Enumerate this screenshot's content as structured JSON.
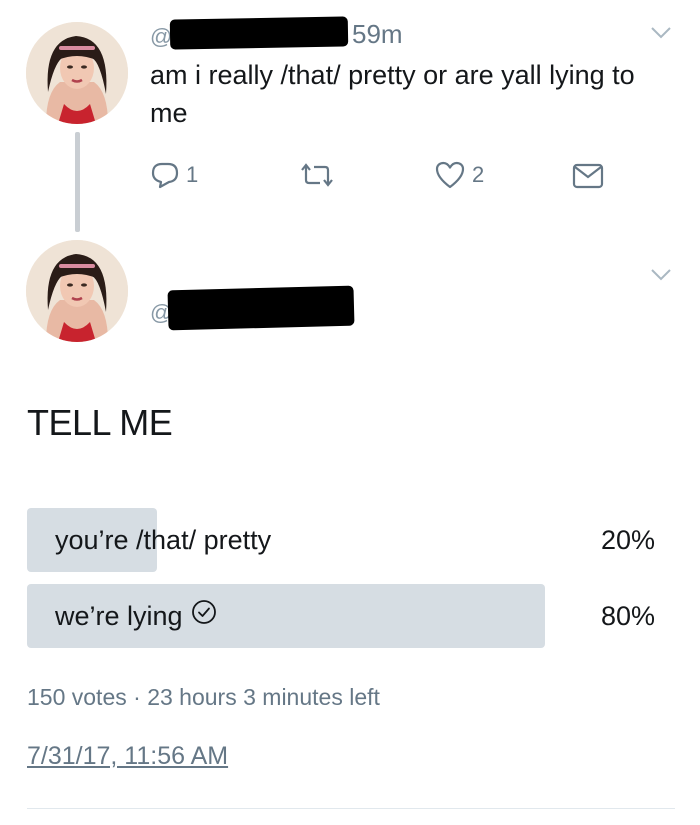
{
  "tweet1": {
    "handle_prefix": "@",
    "time": "59m",
    "text": "am i really /that/ pretty or are yall lying to me",
    "actions": {
      "reply_count": "1",
      "retweet_count": "",
      "like_count": "2"
    }
  },
  "tweet2": {
    "handle_prefix": "@",
    "poll": {
      "question": "TELL ME",
      "options": [
        {
          "label": "you’re /that/ pretty",
          "percent": "20%",
          "fraction": 0.2,
          "selected": false
        },
        {
          "label": "we’re lying",
          "percent": "80%",
          "fraction": 0.8,
          "selected": true
        }
      ],
      "votes": "150 votes",
      "separator": "·",
      "time_left": "23 hours 3 minutes left"
    },
    "timestamp": "7/31/17, 11:56 AM"
  },
  "colors": {
    "text": "#14171a",
    "secondary_text": "#657786",
    "poll_fill": "#d6dde3",
    "thread_line": "#c9ced3"
  },
  "icons": {
    "reply": "reply-icon",
    "retweet": "retweet-icon",
    "like": "heart-icon",
    "dm": "envelope-icon",
    "more": "chevron-down-icon",
    "selected": "check-circle-icon"
  }
}
